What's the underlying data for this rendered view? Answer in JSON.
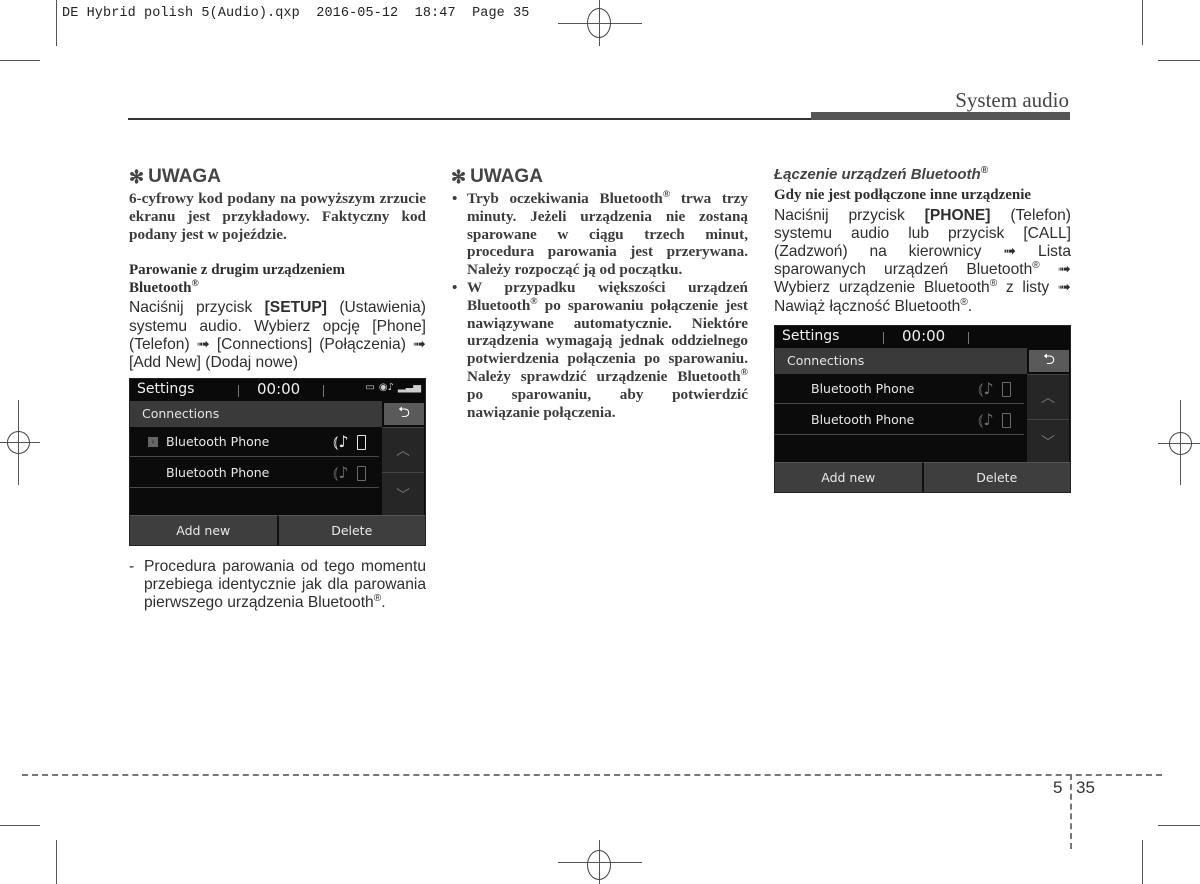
{
  "slug": {
    "text": "DE Hybrid polish 5(Audio).qxp  2016-05-12  18:47  Page 35"
  },
  "header": {
    "section_title": "System audio"
  },
  "column1": {
    "note_heading": "UWAGA",
    "note_icon": "asterisk-icon",
    "note_text": "6-cyfrowy kod podany na powyższym zrzucie ekranu jest przykładowy. Faktyczny kod podany jest w pojeździe.",
    "subheading_line1": "Parowanie z drugim urządzeniem",
    "subheading_line2": "Bluetooth",
    "instruction_part1": "Naciśnij przycisk ",
    "instruction_button": "[SETUP]",
    "instruction_part2": " (Ustawienia) systemu audio. Wybierz opcję [Phone] (Telefon) ➟ [Connections] (Połączenia) ➟ [Add New] (Dodaj nowe)",
    "dash_marker": "-",
    "dash_text": "Procedura parowania od tego momentu przebiega identycznie jak dla parowania pierwszego urządzenia Bluetooth",
    "dash_text_end": "."
  },
  "screen1": {
    "title": "Settings",
    "time": "00:00",
    "status_icons": [
      "battery-icon",
      "bluetooth-audio-icon",
      "signal-icon"
    ],
    "subtitle": "Connections",
    "back_icon": "back-arrow-icon",
    "rows": [
      {
        "label": "Bluetooth Phone",
        "selected": true,
        "audio_active": true,
        "phone_active": true
      },
      {
        "label": "Bluetooth Phone",
        "selected": false,
        "audio_active": false,
        "phone_active": false
      }
    ],
    "scroll_up": "︿",
    "scroll_down": "﹀",
    "buttons": [
      "Add new",
      "Delete"
    ]
  },
  "column2": {
    "note_heading": "UWAGA",
    "bullets": [
      {
        "pre": "Tryb oczekiwania Bluetooth",
        "post": " trwa trzy minuty. Jeżeli urządzenia nie zostaną sparowane w ciągu trzech minut, procedura parowania jest przerywana. Należy rozpocząć ją od początku."
      },
      {
        "pre": "W przypadku większości urządzeń Bluetooth",
        "mid": " po sparowaniu połączenie jest nawiązywane automatycznie. Niektóre urządzenia wymagają jednak oddzielnego potwierdzenia połączenia po sparowaniu. Należy sprawdzić urządzenie Bluetooth",
        "post": " po sparowaniu, aby potwierdzić nawiązanie połączenia."
      }
    ]
  },
  "column3": {
    "italic_heading": "Łączenie urządzeń Bluetooth",
    "subheading": "Gdy nie jest podłączone inne urządzenie",
    "instruction_part1": "Naciśnij przycisk ",
    "instruction_button": "[PHONE]",
    "instruction_part2": " (Telefon) systemu audio lub przycisk [CALL] (Zadzwoń) na kierownicy ➟ Lista sparowanych urządzeń Bluetooth",
    "instruction_part3": " ➟ Wybierz urządzenie Bluetooth",
    "instruction_part4": " z listy ➟ Nawiąż łączność Bluetooth",
    "instruction_end": "."
  },
  "screen2": {
    "title": "Settings",
    "time": "00:00",
    "subtitle": "Connections",
    "rows": [
      {
        "label": "Bluetooth Phone",
        "selected": false
      },
      {
        "label": "Bluetooth Phone",
        "selected": false
      }
    ],
    "scroll_up": "︿",
    "scroll_down": "﹀",
    "buttons": [
      "Add new",
      "Delete"
    ]
  },
  "registered_mark": "®",
  "footer": {
    "chapter": "5",
    "page": "35"
  }
}
